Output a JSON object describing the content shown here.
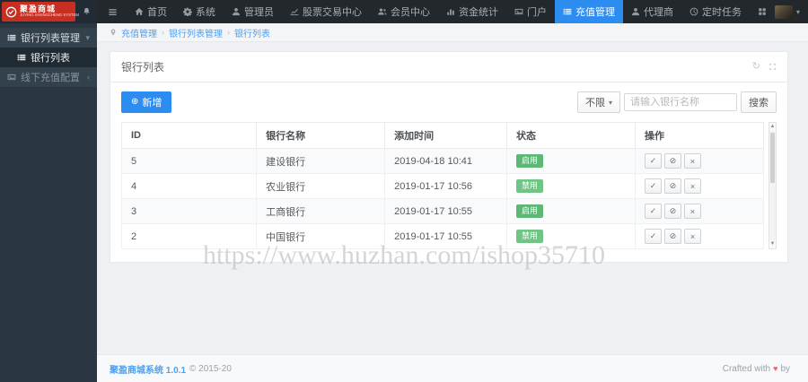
{
  "brand": {
    "logo_text": "聚盈商城",
    "logo_sub": "JUYING SHANGCHENG SYSTEM"
  },
  "topbar": {
    "items": [
      {
        "icon": "home",
        "label": "首页"
      },
      {
        "icon": "gear",
        "label": "系统"
      },
      {
        "icon": "user",
        "label": "管理员"
      },
      {
        "icon": "chart",
        "label": "股票交易中心"
      },
      {
        "icon": "users",
        "label": "会员中心"
      },
      {
        "icon": "bar",
        "label": "资金统计"
      },
      {
        "icon": "image",
        "label": "门户"
      },
      {
        "icon": "list",
        "label": "充值管理",
        "active": true
      },
      {
        "icon": "user",
        "label": "代理商"
      },
      {
        "icon": "clock",
        "label": "定时任务"
      },
      {
        "icon": "grid",
        "label": ""
      }
    ],
    "caret": "▾"
  },
  "breadcrumb": {
    "separator": "›",
    "items": [
      "充值管理",
      "银行列表管理",
      "银行列表"
    ]
  },
  "sidebar": {
    "menu": [
      {
        "icon": "list",
        "label": "银行列表管理",
        "chevron": "▾",
        "children": [
          {
            "icon": "list",
            "label": "银行列表",
            "active": true
          }
        ]
      },
      {
        "icon": "image",
        "label": "线下充值配置",
        "chevron": "‹",
        "dim": true
      }
    ]
  },
  "panel": {
    "title": "银行列表",
    "refresh_glyph": "↻",
    "toolbar": {
      "add_icon": "⊕",
      "add_label": "新增",
      "filter_label": "不限",
      "filter_caret": "▾",
      "search_placeholder": "请输入银行名称",
      "search_label": "搜索"
    }
  },
  "table": {
    "headers": [
      "ID",
      "银行名称",
      "添加时间",
      "状态",
      "操作"
    ],
    "col_widths": [
      "21%",
      "20%",
      "19%",
      "20%",
      "20%"
    ],
    "op_icons": [
      {
        "name": "enable",
        "glyph": "✓"
      },
      {
        "name": "disable",
        "glyph": "⊘"
      },
      {
        "name": "delete",
        "glyph": "×"
      }
    ],
    "rows": [
      {
        "id": "5",
        "name": "建设银行",
        "time": "2019-04-18 10:41",
        "status": "启用",
        "status_color": "#5cb874"
      },
      {
        "id": "4",
        "name": "农业银行",
        "time": "2019-01-17 10:56",
        "status": "禁用",
        "status_color": "#6fc486"
      },
      {
        "id": "3",
        "name": "工商银行",
        "time": "2019-01-17 10:55",
        "status": "启用",
        "status_color": "#5cb874"
      },
      {
        "id": "2",
        "name": "中国银行",
        "time": "2019-01-17 10:55",
        "status": "禁用",
        "status_color": "#6fc486"
      }
    ]
  },
  "watermark": "https://www.huzhan.com/ishop35710",
  "footer": {
    "link": "聚盈商城系统 1.0.1",
    "copy": "© 2015-20",
    "right_prefix": "Crafted with",
    "heart": "♥",
    "right_suffix": "by"
  },
  "colors": {
    "accent_blue": "#2d8cf0",
    "brand_red": "#c62f21",
    "status_on_green": "#5cb874",
    "status_off_green": "#6fc486",
    "heart_red": "#ff5a5f"
  }
}
